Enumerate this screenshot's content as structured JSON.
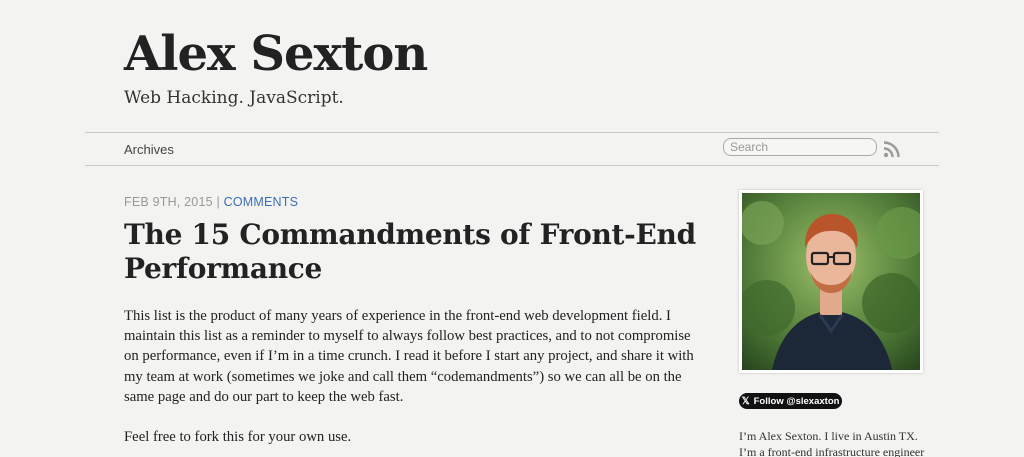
{
  "header": {
    "site_title": "Alex Sexton",
    "tagline": "Web Hacking. JavaScript."
  },
  "nav": {
    "archives_label": "Archives",
    "search_placeholder": "Search",
    "rss_icon": "rss-icon"
  },
  "post": {
    "date": "Feb 9th, 2015",
    "separator": "|",
    "comments_label": "Comments",
    "title": "The 15 Commandments of Front-End Performance",
    "paragraphs": [
      "This list is the product of many years of experience in the front-end web development field. I maintain this list as a reminder to myself to always follow best practices, and to not compromise on performance, even if I’m in a time crunch. I read it before I start any project, and share it with my team at work (sometimes we joke and call them “codemandments”) so we can all be on the same page and do our part to keep the web fast.",
      "Feel free to fork this for your own use."
    ]
  },
  "sidebar": {
    "follow_label": "Follow @slexaxton",
    "bio_line1": "I’m Alex Sexton. I live in Austin TX.",
    "bio_line2": "I’m a front-end infrastructure engineer"
  },
  "colors": {
    "background": "#f3f3f1",
    "link": "#3b6eb3",
    "meta": "#999999"
  }
}
